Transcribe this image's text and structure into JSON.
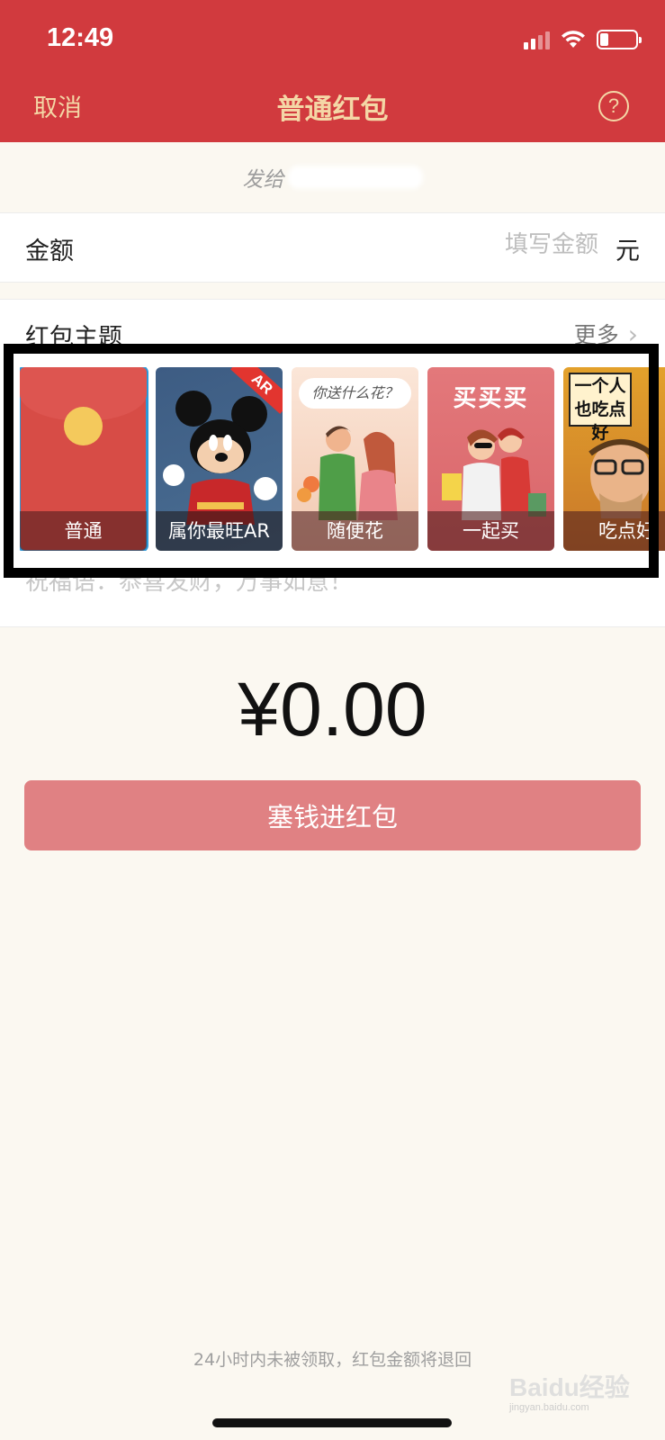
{
  "status_bar": {
    "time": "12:49",
    "battery_level": 0.2,
    "signal_bars": 2
  },
  "nav": {
    "cancel": "取消",
    "title": "普通红包",
    "help_icon": "question-circle-icon"
  },
  "send_to": {
    "label": "发给"
  },
  "amount": {
    "label": "金额",
    "placeholder": "填写金额",
    "unit": "元"
  },
  "theme": {
    "label": "红包主题",
    "more": "更多",
    "cards": [
      {
        "caption": "普通",
        "selected": true
      },
      {
        "caption": "属你最旺AR",
        "badge": "AR"
      },
      {
        "caption": "随便花",
        "bubble": "你送什么花？"
      },
      {
        "caption": "一起买",
        "poster": "买买买"
      },
      {
        "caption": "吃点好",
        "poster": "一个人也吃点好"
      }
    ]
  },
  "blessing": {
    "placeholder": "祝福语：恭喜发财，万事如意！"
  },
  "total": "¥0.00",
  "submit": {
    "label": "塞钱进红包"
  },
  "footer": {
    "note": "24小时内未被领取，红包金额将退回"
  },
  "watermark": {
    "brand": "Baidu经验",
    "domain": "jingyan.baidu.com"
  },
  "colors": {
    "header": "#d13a3e",
    "accent_text": "#f4d7a6",
    "button": "#e08183",
    "background": "#fbf8f1"
  }
}
